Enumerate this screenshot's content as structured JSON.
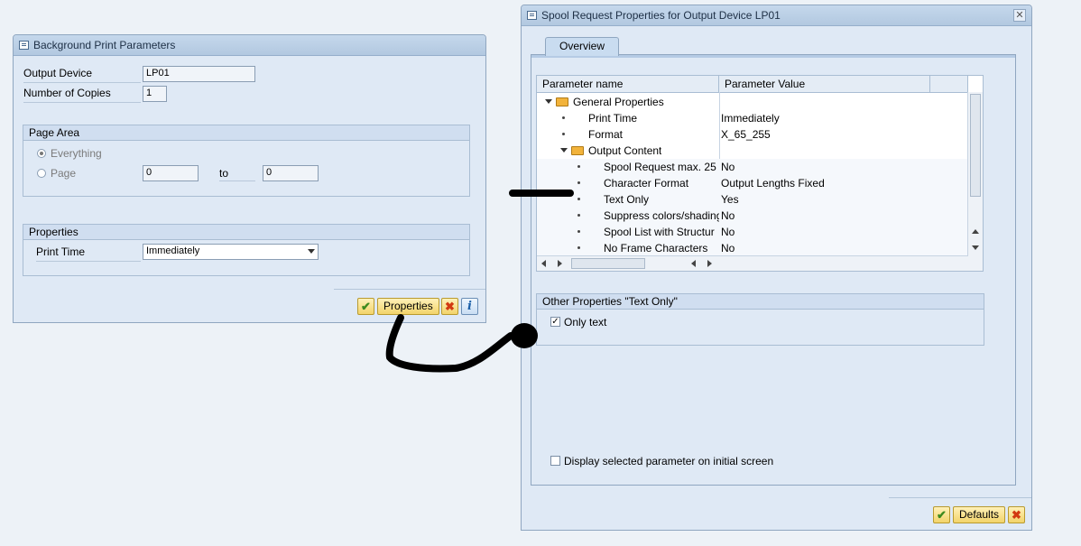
{
  "left_dialog": {
    "title": "Background Print Parameters",
    "output_device_label": "Output Device",
    "output_device_value": "LP01",
    "copies_label": "Number of Copies",
    "copies_value": "1",
    "page_area": {
      "title": "Page Area",
      "everything_label": "Everything",
      "page_label": "Page",
      "from_value": "0",
      "to_label": "to",
      "to_value": "0"
    },
    "properties": {
      "title": "Properties",
      "print_time_label": "Print Time",
      "print_time_value": "Immediately"
    },
    "buttons": {
      "properties_label": "Properties"
    }
  },
  "right_dialog": {
    "title": "Spool Request Properties for Output Device LP01",
    "tab_label": "Overview",
    "tree": {
      "col_name": "Parameter name",
      "col_value": "Parameter Value",
      "rows": [
        {
          "name": "General Properties",
          "value": ""
        },
        {
          "name": "Print Time",
          "value": "Immediately"
        },
        {
          "name": "Format",
          "value": "X_65_255"
        },
        {
          "name": "Output Content",
          "value": ""
        },
        {
          "name": "Spool Request max. 25",
          "value": "No"
        },
        {
          "name": "Character Format",
          "value": "Output Lengths Fixed"
        },
        {
          "name": "Text Only",
          "value": "Yes"
        },
        {
          "name": "Suppress colors/shading",
          "value": "No"
        },
        {
          "name": "Spool List with Structur",
          "value": "No"
        },
        {
          "name": "No Frame Characters",
          "value": "No"
        }
      ]
    },
    "other_props": {
      "title": "Other Properties \"Text Only\"",
      "only_text_label": "Only text"
    },
    "display_selected_label": "Display selected parameter on initial screen",
    "buttons": {
      "defaults_label": "Defaults"
    }
  },
  "colors": {
    "accent": "#f2d36a",
    "window": "#dfe9f5",
    "titlebar": "#b8cde3"
  }
}
